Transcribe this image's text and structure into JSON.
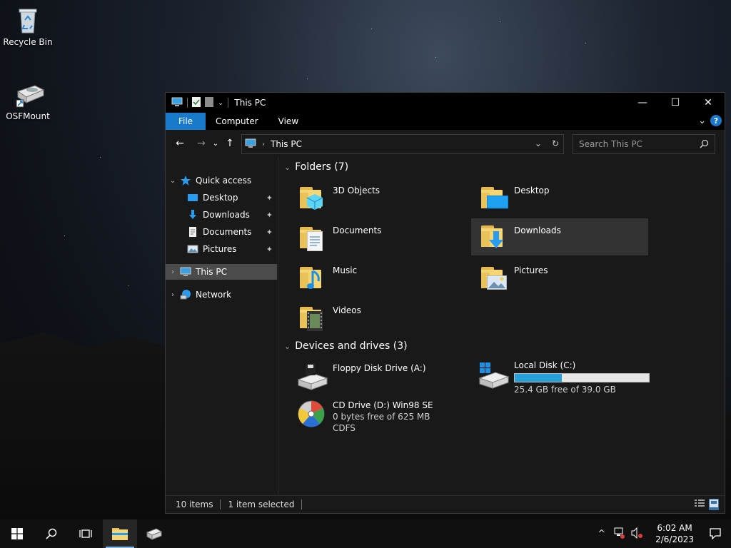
{
  "desktop": {
    "icons": [
      {
        "label": "Recycle Bin",
        "icon": "recycle-bin-icon"
      },
      {
        "label": "OSFMount",
        "icon": "osfmount-icon"
      }
    ]
  },
  "window": {
    "title": "This PC",
    "controls": {
      "minimize": "—",
      "maximize": "☐",
      "close": "✕"
    },
    "ribbon": {
      "tabs": [
        {
          "label": "File"
        },
        {
          "label": "Computer"
        },
        {
          "label": "View"
        }
      ],
      "expand": "⌄",
      "help": "?"
    },
    "nav": {
      "back": "←",
      "forward": "→",
      "recent": "⌄",
      "up": "↑"
    },
    "address": {
      "path": "This PC",
      "dropdown": "⌄",
      "refresh": "↻"
    },
    "search": {
      "placeholder": "Search This PC"
    },
    "sidebar": {
      "quick_access": "Quick access",
      "items": [
        {
          "label": "Desktop",
          "pin": "📌"
        },
        {
          "label": "Downloads",
          "pin": "📌"
        },
        {
          "label": "Documents",
          "pin": "📌"
        },
        {
          "label": "Pictures",
          "pin": "📌"
        }
      ],
      "this_pc": "This PC",
      "network": "Network"
    },
    "content": {
      "folders_header": "Folders (7)",
      "folders": [
        {
          "label": "3D Objects"
        },
        {
          "label": "Desktop"
        },
        {
          "label": "Documents"
        },
        {
          "label": "Downloads"
        },
        {
          "label": "Music"
        },
        {
          "label": "Pictures"
        },
        {
          "label": "Videos"
        }
      ],
      "devices_header": "Devices and drives (3)",
      "drives": [
        {
          "label": "Floppy Disk Drive (A:)"
        },
        {
          "label": "Local Disk (C:)",
          "free": "25.4 GB free of 39.0 GB",
          "used_fraction": 0.35
        },
        {
          "label": "CD Drive (D:) Win98 SE",
          "line2": "0 bytes free of 625 MB",
          "line3": "CDFS"
        }
      ]
    },
    "status": {
      "items": "10 items",
      "selected": "1 item selected"
    }
  },
  "taskbar": {
    "time": "6:02 AM",
    "date": "2/6/2023",
    "tray_chevron": "^"
  },
  "colors": {
    "accent": "#1979ca",
    "progress": "#26a0da"
  }
}
